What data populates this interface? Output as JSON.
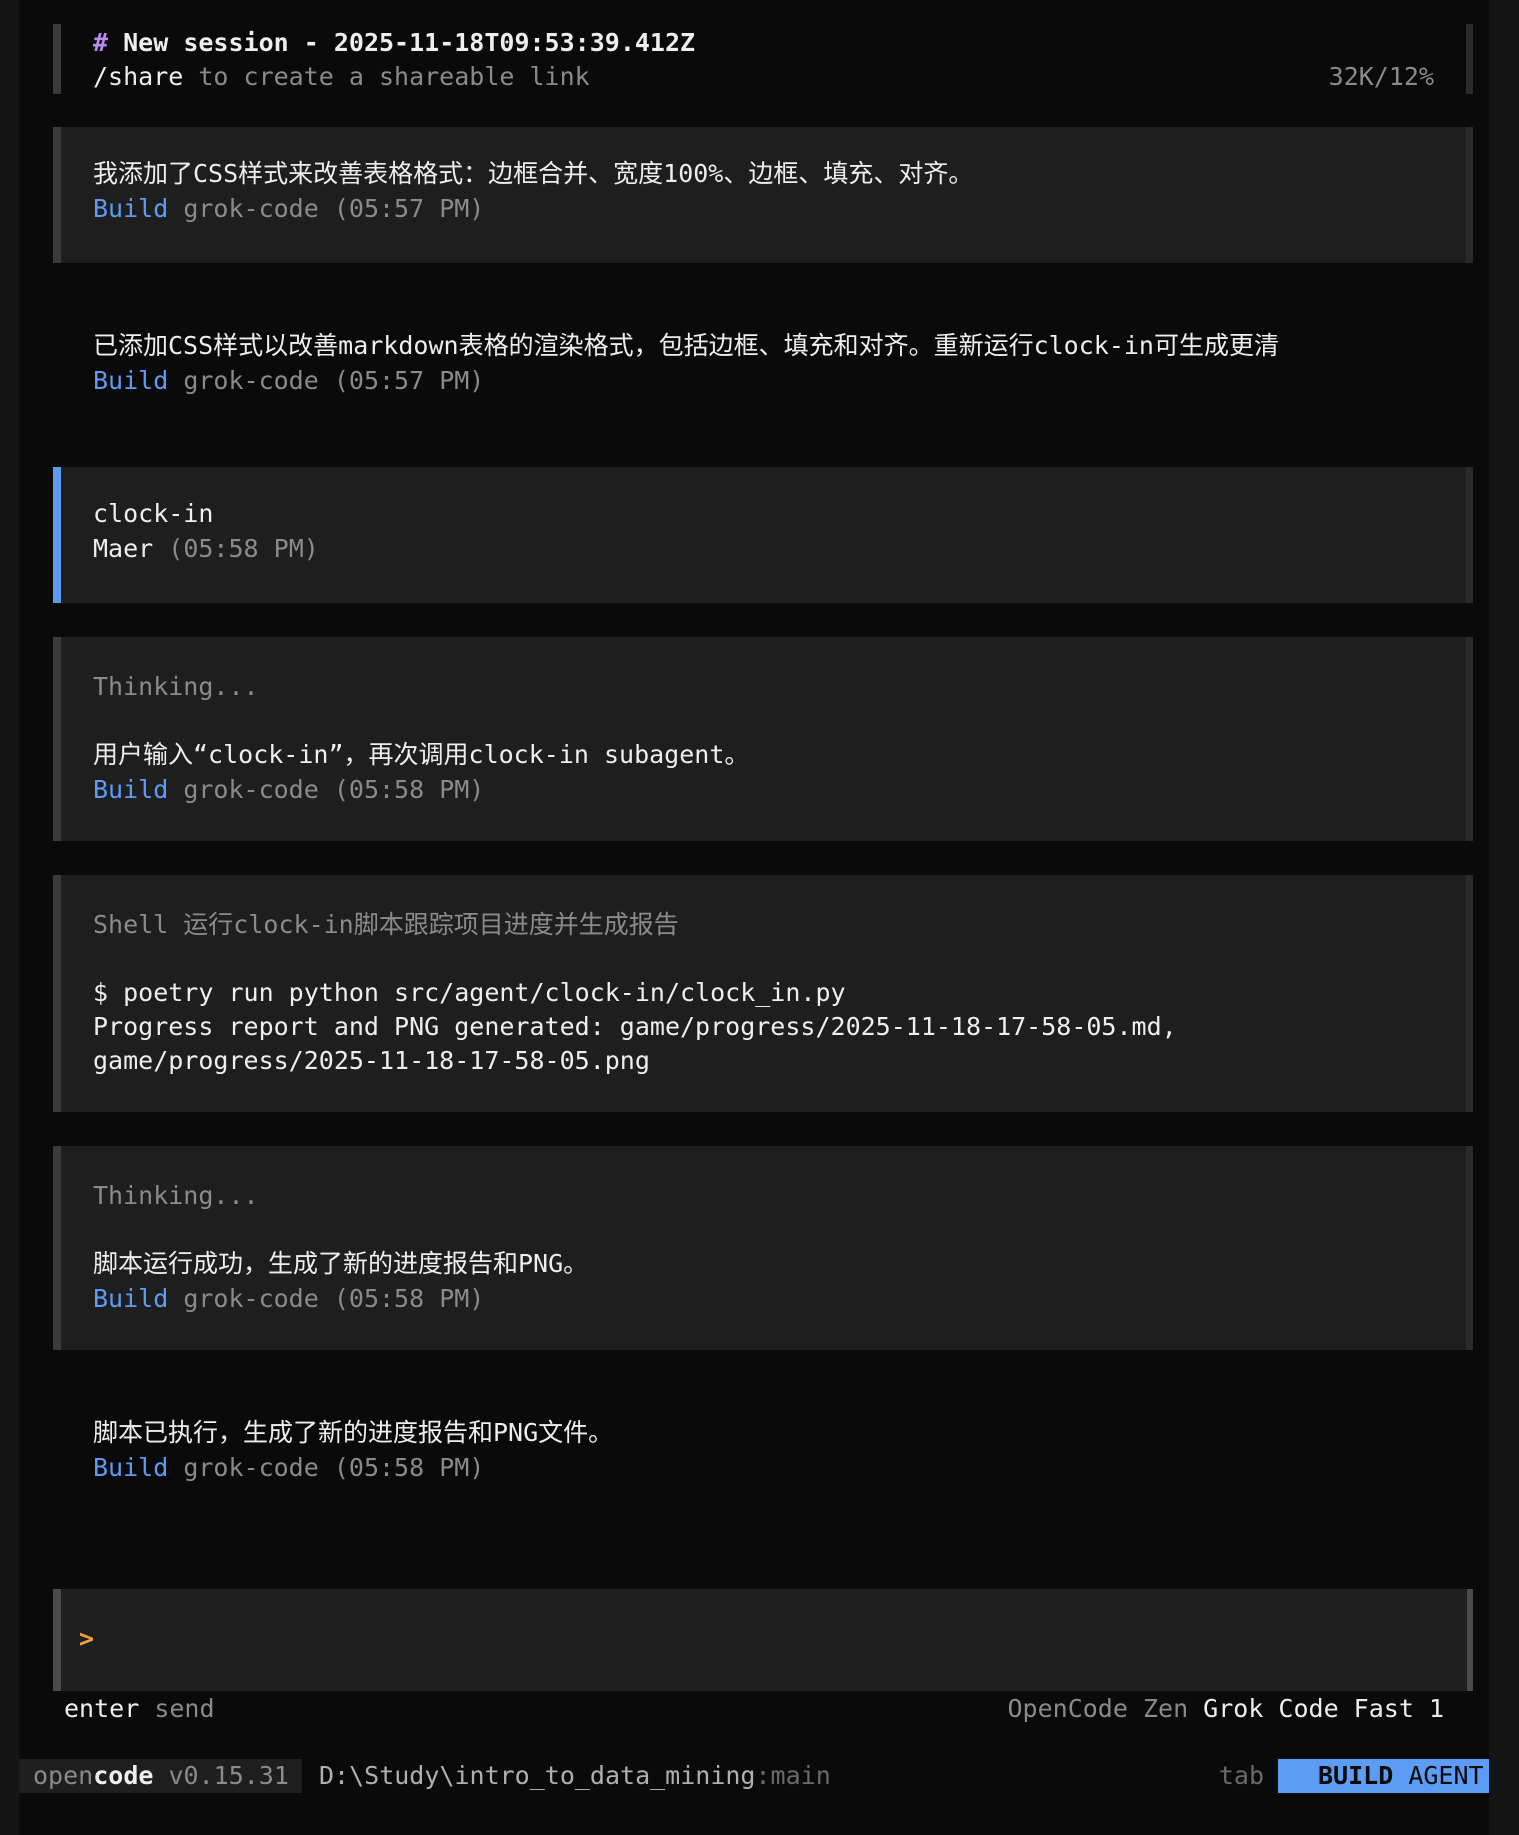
{
  "header": {
    "hash": "#",
    "title": "New session - 2025-11-18T09:53:39.412Z",
    "share_cmd": "/share",
    "share_text": " to create a shareable link",
    "usage": "32K/12%"
  },
  "messages": [
    {
      "text": "我添加了CSS样式来改善表格格式：边框合并、宽度100%、边框、填充、对齐。",
      "mode": "Build",
      "meta": "grok-code (05:57 PM)"
    },
    {
      "text": "已添加CSS样式以改善markdown表格的渲染格式，包括边框、填充和对齐。重新运行clock-in可生成更清",
      "mode": "Build",
      "meta": "grok-code (05:57 PM)"
    },
    {
      "user_text": "clock-in",
      "user_name": "Maer",
      "user_time": "(05:58 PM)"
    },
    {
      "thinking": "Thinking...",
      "text": "用户输入“clock-in”，再次调用clock-in subagent。",
      "mode": "Build",
      "meta": "grok-code (05:58 PM)"
    },
    {
      "tool_title": "Shell 运行clock-in脚本跟踪项目进度并生成报告",
      "cmd": "$ poetry run python src/agent/clock-in/clock_in.py",
      "out1": "Progress report and PNG generated: game/progress/2025-11-18-17-58-05.md,",
      "out2": "game/progress/2025-11-18-17-58-05.png"
    },
    {
      "thinking": "Thinking...",
      "text": "脚本运行成功，生成了新的进度报告和PNG。",
      "mode": "Build",
      "meta": "grok-code (05:58 PM)"
    },
    {
      "text": "脚本已执行，生成了新的进度报告和PNG文件。",
      "mode": "Build",
      "meta": "grok-code (05:58 PM)"
    }
  ],
  "input": {
    "prompt": ">",
    "value": ""
  },
  "hints": {
    "enter": "enter",
    "send": " send",
    "provider": "OpenCode Zen ",
    "model": "Grok Code Fast 1"
  },
  "status": {
    "app_light": "open",
    "app_bold": "code",
    "version": " v0.15.31",
    "path": "D:\\Study\\intro_to_data_mining",
    "branch": ":main",
    "tab": "tab",
    "agent_bold": "BUILD",
    "agent_rest": " AGENT"
  },
  "colors": {
    "accent": "#5c9cf5",
    "background": "#0a0a0a",
    "panel": "#1e1e1e",
    "prompt": "#f0a04b"
  }
}
